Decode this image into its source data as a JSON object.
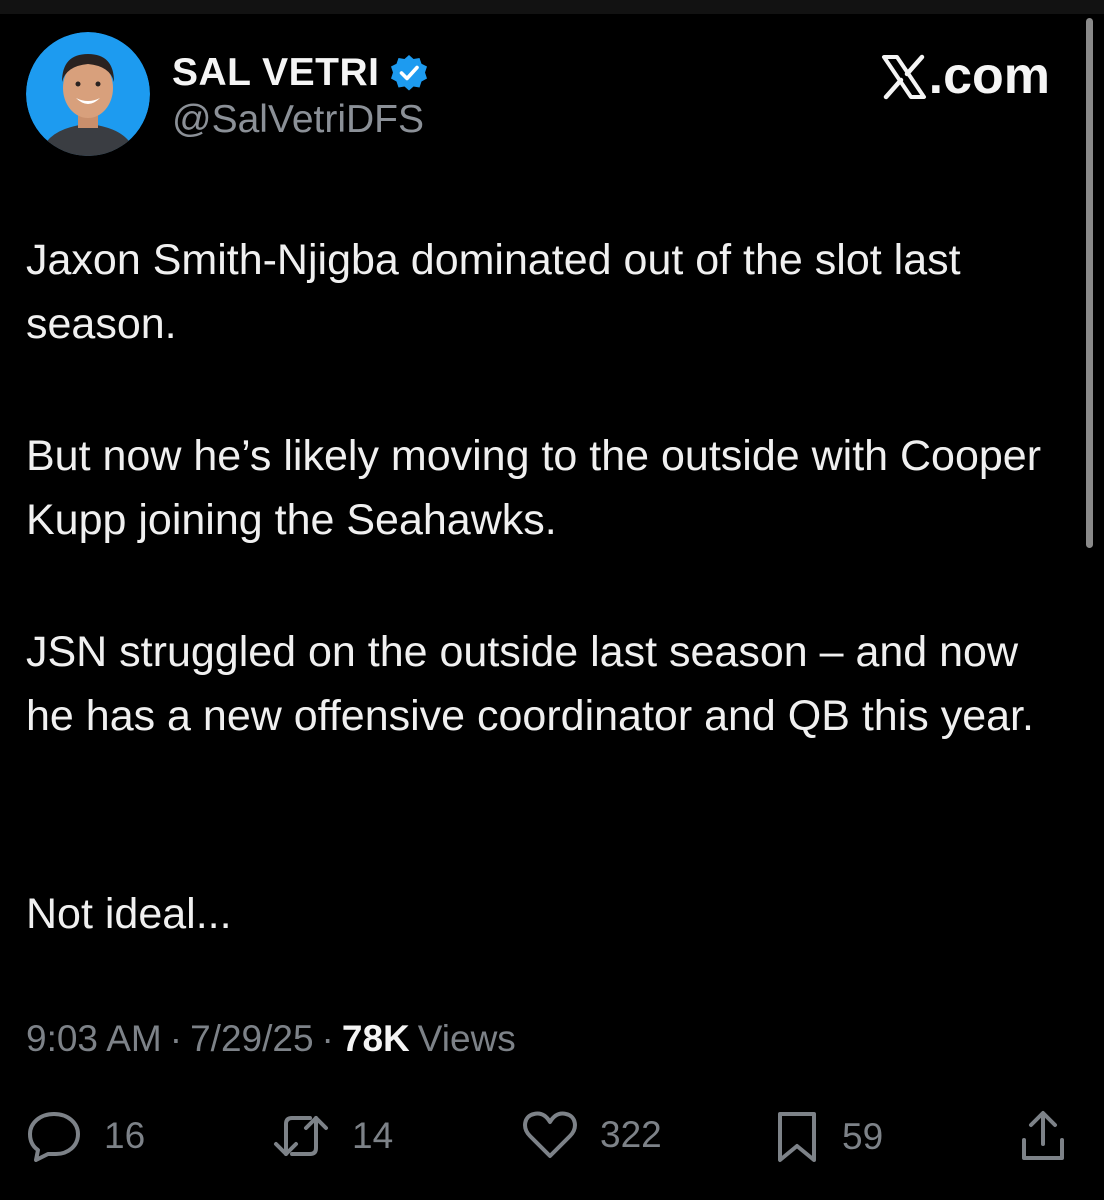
{
  "author": {
    "name": "SAL VETRI",
    "handle": "@SalVetriDFS",
    "verified": true,
    "avatar_bg": "#1d9bf0"
  },
  "brand": {
    "label": ".com",
    "logo_icon": "x-logo-icon"
  },
  "post": {
    "paragraphs": [
      "Jaxon Smith-Njigba dominated out of the slot last season.",
      "But now he’s likely moving to the outside with Cooper Kupp joining the Seahawks.",
      "JSN struggled on the outside last season – and now he has a new offensive coordinator and QB this year.",
      "Not ideal..."
    ]
  },
  "meta": {
    "time": "9:03 AM",
    "sep1": "·",
    "date": "7/29/25",
    "sep2": "·",
    "views_count": "78K",
    "views_label": "Views"
  },
  "actions": {
    "replies": "16",
    "reposts": "14",
    "likes": "322",
    "bookmarks": "59"
  },
  "colors": {
    "background": "#000000",
    "text": "#e7e9ea",
    "muted": "#7d8288",
    "verified": "#1d9bf0"
  }
}
